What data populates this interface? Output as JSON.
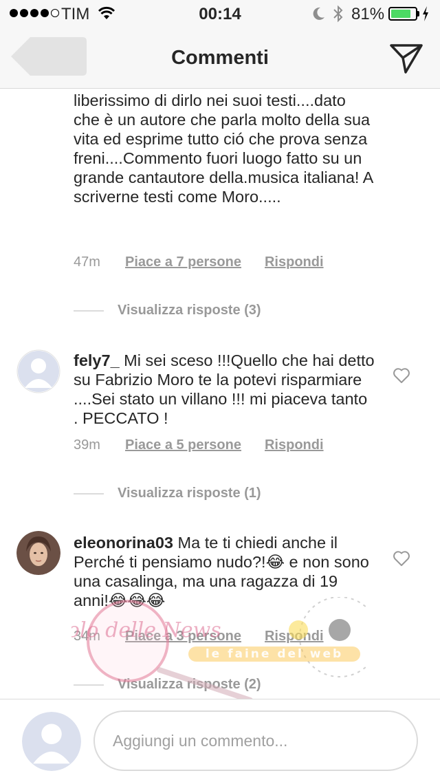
{
  "status_bar": {
    "carrier": "TIM",
    "time": "00:14",
    "battery_percent": "81%",
    "battery_level": 0.81,
    "battery_color": "#4cd964"
  },
  "nav": {
    "title": "Commenti",
    "back_icon": "back-arrow-icon",
    "share_icon": "send-icon"
  },
  "comments": [
    {
      "text": "liberissimo di dirlo nei suoi testi....dato che è un autore che parla molto della sua vita ed esprime tutto ció che prova senza freni....Commento fuori luogo fatto su un grande cantautore della.musica italiana! A scriverne testi come Moro.....",
      "time": "47m",
      "likes": "Piace a 7 persone",
      "reply": "Rispondi",
      "view_replies": "Visualizza risposte (3)"
    },
    {
      "user": "fely7_",
      "text": " Mi sei sceso !!!Quello che hai detto su Fabrizio Moro te la potevi risparmiare ....Sei stato un villano !!! mi piaceva tanto . PECCATO !",
      "time": "39m",
      "likes": "Piace a 5 persone",
      "reply": "Rispondi",
      "view_replies": "Visualizza risposte (1)"
    },
    {
      "user": "eleonorina03",
      "text": " Ma te ti chiedi anche il Perché ti pensiamo nudo?!😂 e non sono una casalinga, ma una ragazza di 19 anni!😂😂😂",
      "time": "34m",
      "likes": "Piace a 3 persone",
      "reply": "Rispondi",
      "view_replies": "Visualizza risposte (2)"
    }
  ],
  "compose": {
    "placeholder": "Aggiungi un commento..."
  },
  "watermark": {
    "text": "Vicolo delle News",
    "text2": "le faine del web"
  }
}
